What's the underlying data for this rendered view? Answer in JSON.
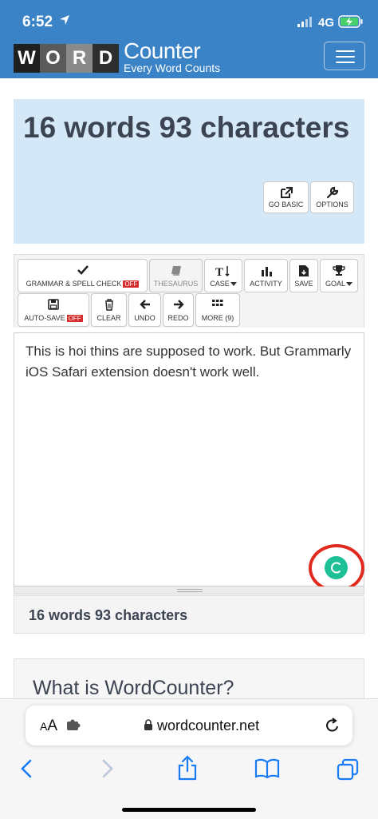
{
  "status_bar": {
    "time": "6:52",
    "network": "4G"
  },
  "site": {
    "logo_letters": [
      "W",
      "O",
      "R",
      "D"
    ],
    "logo_colors": [
      "#1f1f1f",
      "#5a5a5a",
      "#8a8a8a",
      "#2e2e2e"
    ],
    "logo_word": "Counter",
    "logo_tagline": "Every Word Counts"
  },
  "summary": {
    "title": "16 words 93 characters",
    "go_basic_label": "GO BASIC",
    "options_label": "OPTIONS"
  },
  "toolbar": {
    "grammar_label": "GRAMMAR & SPELL CHECK",
    "grammar_state": "OFF",
    "thesaurus_label": "THESAURUS",
    "case_label": "CASE",
    "activity_label": "ACTIVITY",
    "save_label": "SAVE",
    "goal_label": "GOAL",
    "autosave_label": "AUTO-SAVE",
    "autosave_state": "OFF",
    "clear_label": "CLEAR",
    "undo_label": "UNDO",
    "redo_label": "REDO",
    "more_label": "MORE (9)"
  },
  "editor": {
    "text": "This is hoi thins are supposed to work. But Grammarly iOS Safari extension doesn't work well."
  },
  "bottom_count": "16 words 93 characters",
  "about_title": "What is WordCounter?",
  "safari": {
    "aa_label": "AA",
    "url": "wordcounter.net"
  },
  "colors": {
    "header_blue": "#3a83c6",
    "summary_bg": "#d4e8f7",
    "off_red": "#d62b2b",
    "grammarly_green": "#1ec197",
    "highlight_ring": "#e02a1d",
    "ios_blue": "#1a7cf5"
  }
}
